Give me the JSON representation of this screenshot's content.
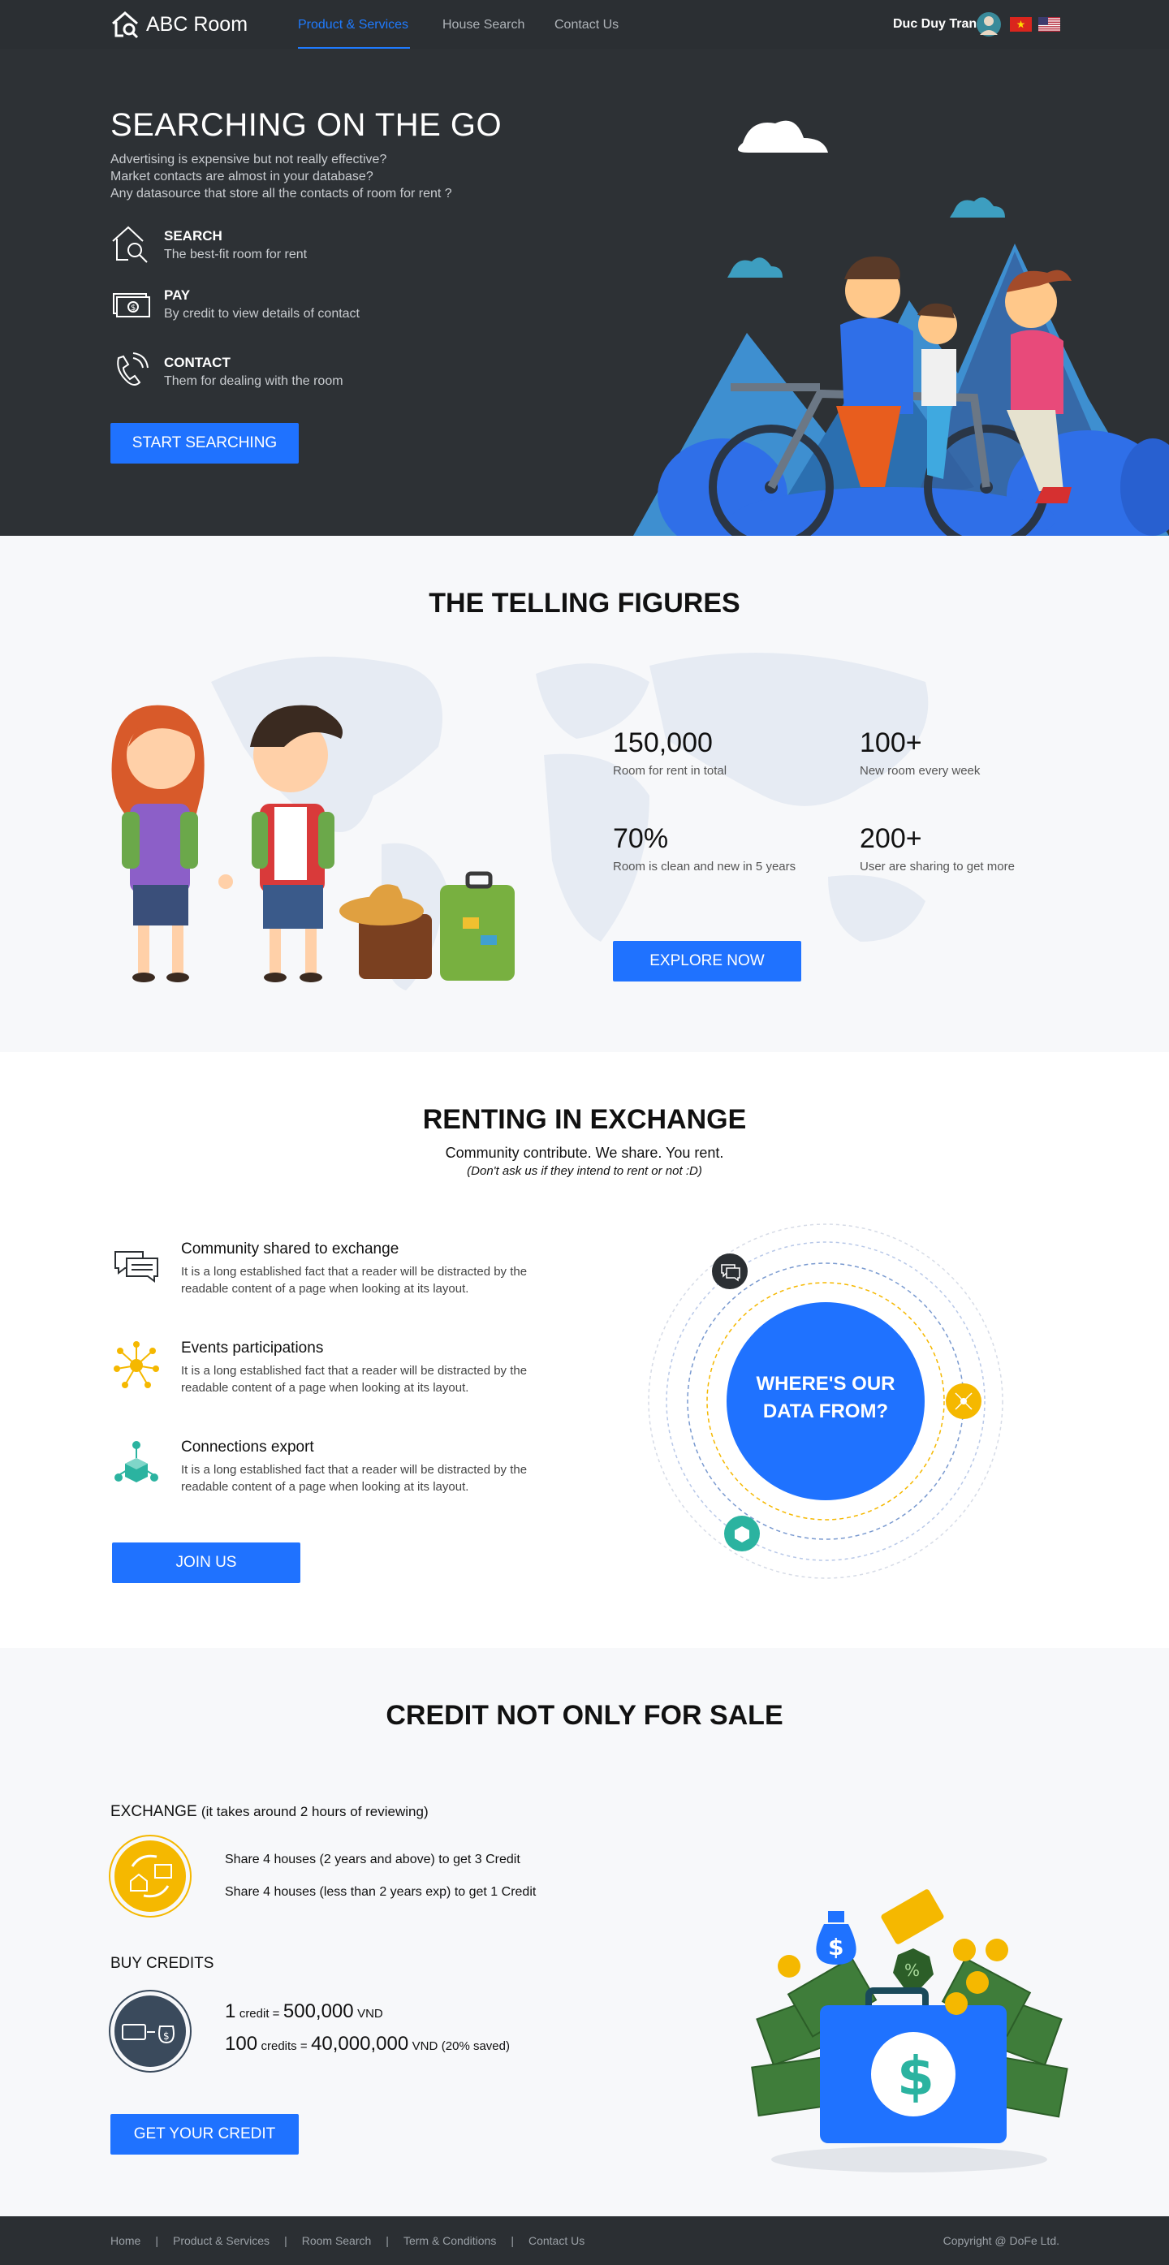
{
  "nav": {
    "brand": "ABC Room",
    "links": [
      "Product &  Services",
      "House Search",
      "Contact Us"
    ],
    "user_name": "Duc Duy Tran"
  },
  "hero": {
    "title": "SEARCHING ON THE GO",
    "sub1": "Advertising is expensive but not really effective?",
    "sub2": "Market contacts are almost in your database?",
    "sub3": "Any datasource that store all the contacts of room for rent ?",
    "features": [
      {
        "title": "SEARCH",
        "desc": "The best-fit room for rent"
      },
      {
        "title": "PAY",
        "desc": "By credit to view details of contact"
      },
      {
        "title": "CONTACT",
        "desc": "Them for dealing with the room"
      }
    ],
    "cta": "START SEARCHING"
  },
  "figures": {
    "title": "THE TELLING FIGURES",
    "stats": [
      {
        "value": "150,000",
        "label": "Room for rent in total"
      },
      {
        "value": "100+",
        "label": "New room every week"
      },
      {
        "value": "70%",
        "label": "Room is clean and new in 5 years"
      },
      {
        "value": "200+",
        "label": "User are sharing to get more"
      }
    ],
    "cta": "EXPLORE NOW"
  },
  "renting": {
    "title": "RENTING IN EXCHANGE",
    "sub": "Community contribute. We share. You rent.",
    "sub2": "(Don't ask us if they intend to rent or not :D)",
    "items": [
      {
        "title": "Community shared to exchange",
        "desc": "It is a long established fact that a reader will be distracted by the readable content of a page when looking at its layout."
      },
      {
        "title": "Events participations",
        "desc": "It is a long established fact that a reader will be distracted by the readable content of a page when looking at its layout."
      },
      {
        "title": "Connections export",
        "desc": "It is a long established fact that a reader will be distracted by the readable content of a page when looking at its layout."
      }
    ],
    "cta": "JOIN US",
    "circle_line1": "WHERE'S OUR",
    "circle_line2": "DATA FROM?"
  },
  "credit": {
    "title": "CREDIT NOT ONLY FOR SALE",
    "exchange_head": "EXCHANGE",
    "exchange_note": "(it takes around 2 hours of reviewing)",
    "exchange_lines": [
      "Share 4 houses (2 years and above) to get 3 Credit",
      "Share 4 houses (less than 2 years exp) to get 1 Credit"
    ],
    "buy_head": "BUY CREDITS",
    "prices": [
      {
        "qty": "1",
        "unit": "credit =",
        "amount": "500,000",
        "cur": "VND",
        "note": ""
      },
      {
        "qty": "100",
        "unit": "credits =",
        "amount": "40,000,000",
        "cur": "VND",
        "note": "(20% saved)"
      }
    ],
    "cta": "GET YOUR CREDIT"
  },
  "footer": {
    "links": [
      "Home",
      "Product & Services",
      "Room  Search",
      "Term & Conditions",
      "Contact Us"
    ],
    "copyright": "Copyright @ DoFe Ltd."
  },
  "colors": {
    "accent": "#1f72ff",
    "dark": "#2d3135",
    "light_bg": "#f7f8fa",
    "yellow": "#f5b800",
    "teal": "#2bb3a0"
  }
}
